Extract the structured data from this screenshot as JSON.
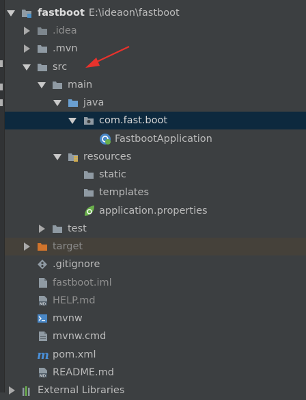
{
  "tree": {
    "root": {
      "name": "fastboot",
      "path": "E:\\ideaon\\fastboot"
    },
    "items": [
      {
        "label": ".idea"
      },
      {
        "label": ".mvn"
      },
      {
        "label": "src"
      },
      {
        "label": "main"
      },
      {
        "label": "java"
      },
      {
        "label": "com.fast.boot"
      },
      {
        "label": "FastbootApplication"
      },
      {
        "label": "resources"
      },
      {
        "label": "static"
      },
      {
        "label": "templates"
      },
      {
        "label": "application.properties"
      },
      {
        "label": "test"
      },
      {
        "label": "target"
      },
      {
        "label": ".gitignore"
      },
      {
        "label": "fastboot.iml"
      },
      {
        "label": "HELP.md"
      },
      {
        "label": "mvnw"
      },
      {
        "label": "mvnw.cmd"
      },
      {
        "label": "pom.xml"
      },
      {
        "label": "README.md"
      },
      {
        "label": "External Libraries"
      }
    ]
  },
  "colors": {
    "background": "#3c3f41",
    "selection": "#0d293e",
    "excluded_row": "#45413a",
    "annotation_arrow": "#e8322c",
    "folder": "#8f9aa3",
    "source_folder": "#6a9fd1",
    "excluded_folder": "#d0742c",
    "spring_green": "#6ab04c"
  },
  "icons": {
    "annotation": "red-pointer-arrow",
    "module": "module-folder-icon",
    "folder": "folder-icon",
    "source_root": "source-root-folder-icon",
    "package": "package-icon",
    "resources": "resources-folder-icon",
    "spring_class": "spring-boot-class-icon",
    "spring_props": "spring-properties-icon",
    "excluded": "excluded-folder-icon",
    "git": "gitignore-icon",
    "file": "file-icon",
    "markdown": "markdown-icon",
    "shell": "shell-script-icon",
    "maven": "maven-pom-icon",
    "libraries": "libraries-icon"
  }
}
